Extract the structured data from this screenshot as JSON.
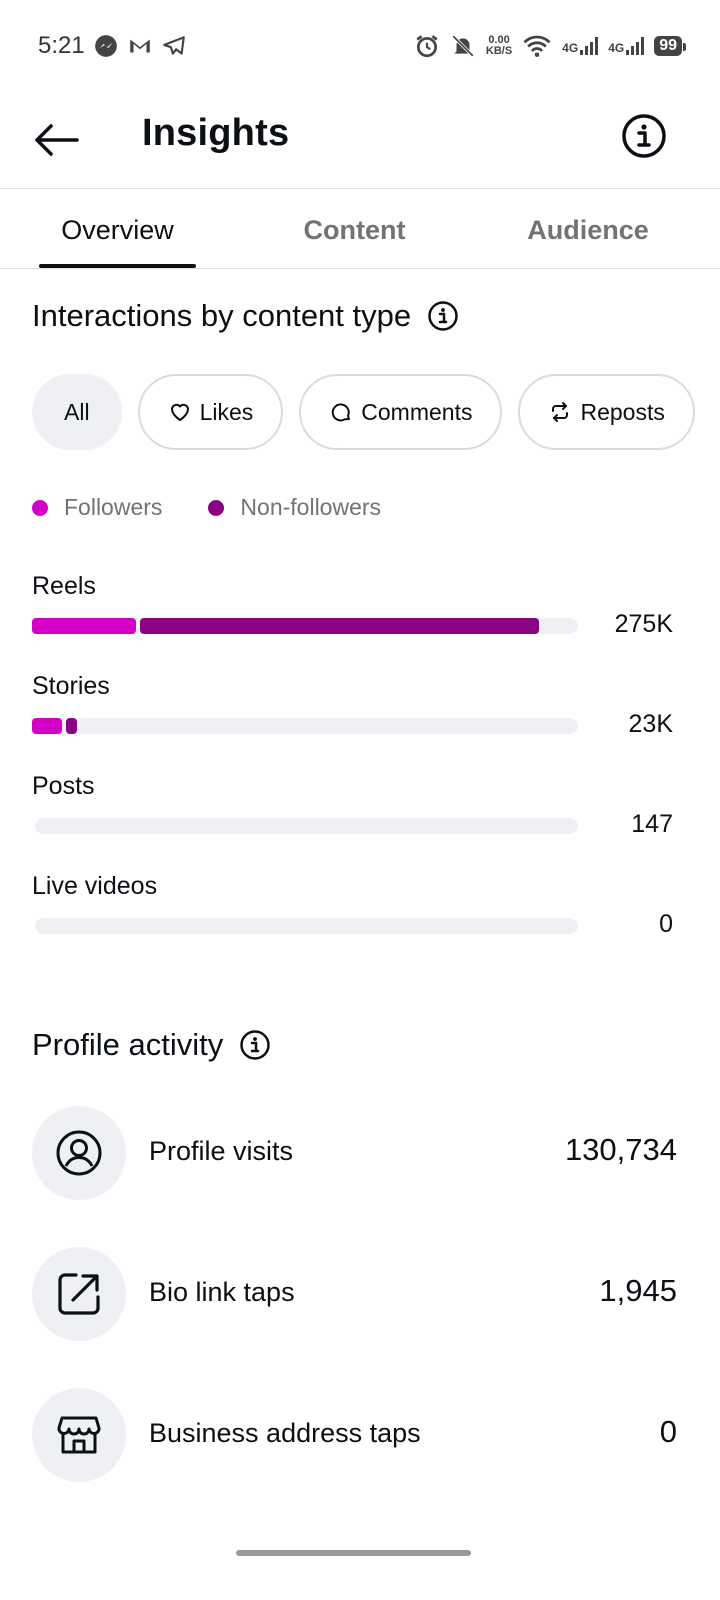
{
  "status_bar": {
    "time": "5:21",
    "speed_value": "0.00",
    "speed_unit": "KB/S",
    "net1": "4G",
    "net2": "4G",
    "battery": "99"
  },
  "header": {
    "title": "Insights"
  },
  "tabs": [
    {
      "label": "Overview",
      "active": true
    },
    {
      "label": "Content",
      "active": false
    },
    {
      "label": "Audience",
      "active": false
    }
  ],
  "interactions": {
    "title": "Interactions by content type",
    "chips": [
      {
        "label": "All",
        "icon": "none",
        "active": true
      },
      {
        "label": "Likes",
        "icon": "heart-icon",
        "active": false
      },
      {
        "label": "Comments",
        "icon": "comment-icon",
        "active": false
      },
      {
        "label": "Reposts",
        "icon": "repost-icon",
        "active": false
      }
    ],
    "legend": [
      {
        "label": "Followers",
        "color": "#d300c5"
      },
      {
        "label": "Non-followers",
        "color": "#8a0385"
      }
    ],
    "rows": [
      {
        "label": "Reels",
        "value": "275K",
        "followers_fraction": 0.19,
        "nonfollowers_fraction": 0.73
      },
      {
        "label": "Stories",
        "value": "23K",
        "followers_fraction": 0.055,
        "nonfollowers_fraction": 0.02
      },
      {
        "label": "Posts",
        "value": "147",
        "followers_fraction": 0,
        "nonfollowers_fraction": 0
      },
      {
        "label": "Live videos",
        "value": "0",
        "followers_fraction": 0,
        "nonfollowers_fraction": 0
      }
    ]
  },
  "profile_activity": {
    "title": "Profile activity",
    "items": [
      {
        "label": "Profile visits",
        "value": "130,734",
        "icon": "profile-icon"
      },
      {
        "label": "Bio link taps",
        "value": "1,945",
        "icon": "external-link-icon"
      },
      {
        "label": "Business address taps",
        "value": "0",
        "icon": "storefront-icon"
      }
    ]
  }
}
